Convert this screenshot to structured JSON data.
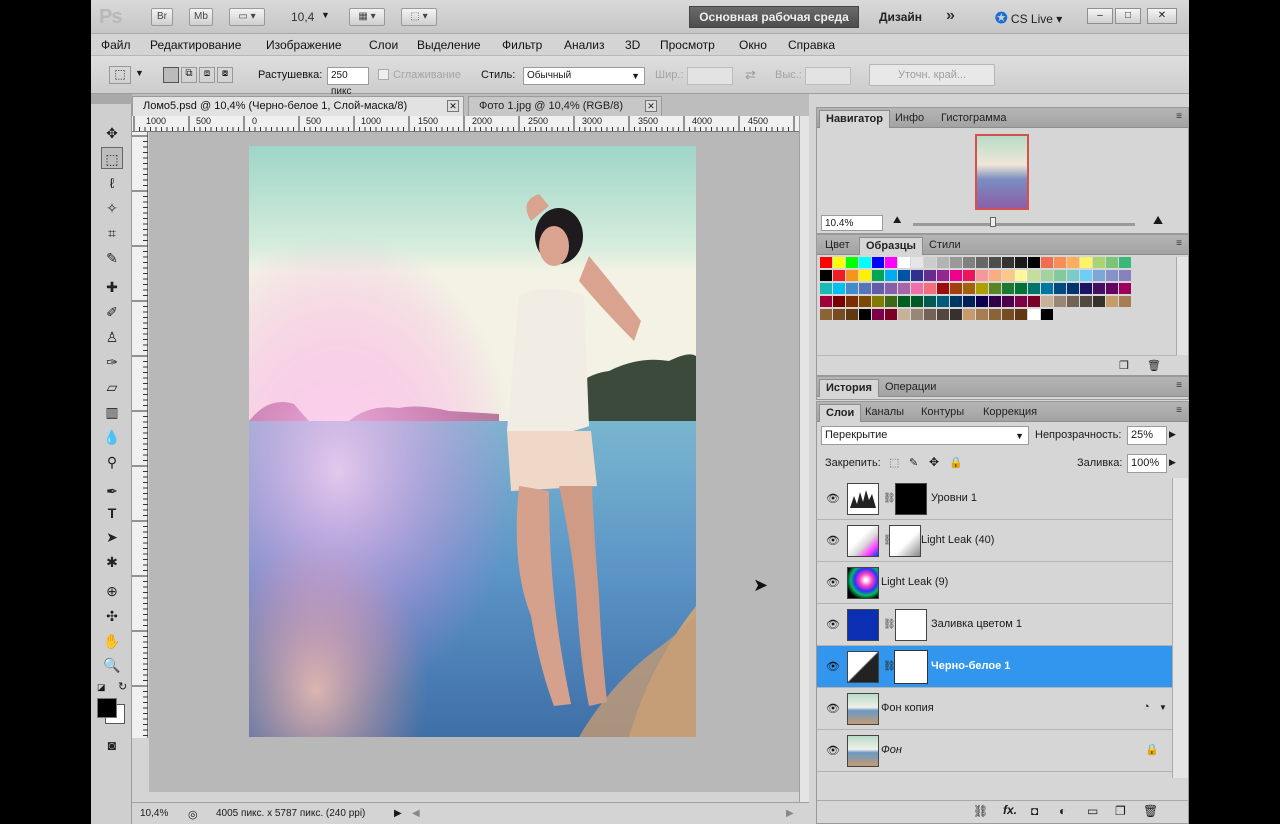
{
  "titlebar": {
    "app_logo": "Ps",
    "bridge_btn": "Br",
    "mini_bridge_btn": "Mb",
    "zoom": "10,4",
    "workspace_active": "Основная рабочая среда",
    "workspace_design": "Дизайн",
    "more": "»",
    "cs_live": "CS Live",
    "minimize": "–",
    "maximize": "□",
    "close": "✕"
  },
  "menu": [
    "Файл",
    "Редактирование",
    "Изображение",
    "Слои",
    "Выделение",
    "Фильтр",
    "Анализ",
    "3D",
    "Просмотр",
    "Окно",
    "Справка"
  ],
  "options": {
    "feather_label": "Растушевка:",
    "feather_value": "250 пикс",
    "antialias_label": "Сглаживание",
    "style_label": "Стиль:",
    "style_value": "Обычный",
    "width_label": "Шир.:",
    "height_label": "Выс.:",
    "refine_edge": "Уточн. край..."
  },
  "doc_tabs": [
    {
      "label": "Ломо5.psd @ 10,4% (Черно-белое 1, Слой-маска/8)",
      "active": true
    },
    {
      "label": "Фото 1.jpg @ 10,4% (RGB/8)",
      "active": false
    }
  ],
  "ruler_labels": [
    "1000",
    "500",
    "0",
    "500",
    "1000",
    "1500",
    "2000",
    "2500",
    "3000",
    "3500",
    "4000",
    "4500"
  ],
  "status": {
    "zoom": "10,4%",
    "doc_info": "4005 пикс. x 5787 пикс. (240 ppi)"
  },
  "navigator_panel": {
    "tabs": [
      "Навигатор",
      "Инфо",
      "Гистограмма"
    ],
    "zoom": "10.4%"
  },
  "swatches_panel": {
    "tabs": [
      "Цвет",
      "Образцы",
      "Стили"
    ],
    "colors": [
      [
        "#ff0000",
        "#ffff00",
        "#00ff00",
        "#00ffff",
        "#0000ff",
        "#ff00ff",
        "#ffffff",
        "#e6e6e6",
        "#cccccc",
        "#b3b3b3",
        "#999999",
        "#808080",
        "#666666",
        "#4d4d4d",
        "#333333",
        "#1a1a1a",
        "#000000",
        "#f26c4f",
        "#f68e55",
        "#fbaf5d",
        "#fff467",
        "#acd372",
        "#7cc576",
        "#3bb878"
      ],
      [
        "#000000",
        "#ee1d24",
        "#f7941d",
        "#fff200",
        "#00a651",
        "#00aeef",
        "#0054a6",
        "#2e3192",
        "#662d91",
        "#92278f",
        "#ec008c",
        "#ed145b",
        "#f5989d",
        "#f9ad81",
        "#fdc68a",
        "#fff799",
        "#c4df9b",
        "#a3d39c",
        "#82ca9c",
        "#7accc8",
        "#6dcff6",
        "#7da7d9",
        "#8393ca",
        "#8781bd"
      ],
      [
        "#1abbb4",
        "#00bff3",
        "#438ccb",
        "#5574b9",
        "#605ca8",
        "#855fa8",
        "#a864a8",
        "#f06eaa",
        "#f26d7d",
        "#9e0b0f",
        "#a0410d",
        "#a36209",
        "#aba000",
        "#598527",
        "#1a7b30",
        "#007236",
        "#00746b",
        "#0076a3",
        "#004a80",
        "#003471",
        "#1b1464",
        "#440e62",
        "#630460",
        "#9e005d"
      ],
      [
        "#9e0039",
        "#790000",
        "#7b2e00",
        "#7d4900",
        "#827b00",
        "#406618",
        "#005e20",
        "#005826",
        "#005952",
        "#005b7f",
        "#003663",
        "#002157",
        "#0d004c",
        "#32004b",
        "#4b0049",
        "#7b0046",
        "#7a0026",
        "#c7b299",
        "#998675",
        "#736357",
        "#534741",
        "#37302d",
        "#c69c6d",
        "#a67c52"
      ],
      [
        "#8c6239",
        "#754c24",
        "#603913",
        "#000000",
        "#7b0046",
        "#7a0026",
        "#c7b299",
        "#998675",
        "#736357",
        "#534741",
        "#37302d",
        "#c69c6d",
        "#a67c52",
        "#8c6239",
        "#754c24",
        "#603913",
        "#ffffff",
        "#000000"
      ]
    ]
  },
  "history_panel": {
    "tabs": [
      "История",
      "Операции"
    ]
  },
  "layers_panel": {
    "tabs": [
      "Слои",
      "Каналы",
      "Контуры",
      "Коррекция"
    ],
    "blend_mode": "Перекрытие",
    "opacity_label": "Непрозрачность:",
    "opacity_value": "25%",
    "lock_label": "Закрепить:",
    "fill_label": "Заливка:",
    "fill_value": "100%",
    "layers": [
      {
        "name": "Уровни 1",
        "selected": false
      },
      {
        "name": "Light Leak (40)",
        "selected": false
      },
      {
        "name": "Light Leak (9)",
        "selected": false
      },
      {
        "name": "Заливка цветом 1",
        "selected": false
      },
      {
        "name": "Черно-белое 1",
        "selected": true
      },
      {
        "name": "Фон копия",
        "selected": false
      },
      {
        "name": "Фон",
        "selected": false
      }
    ]
  }
}
